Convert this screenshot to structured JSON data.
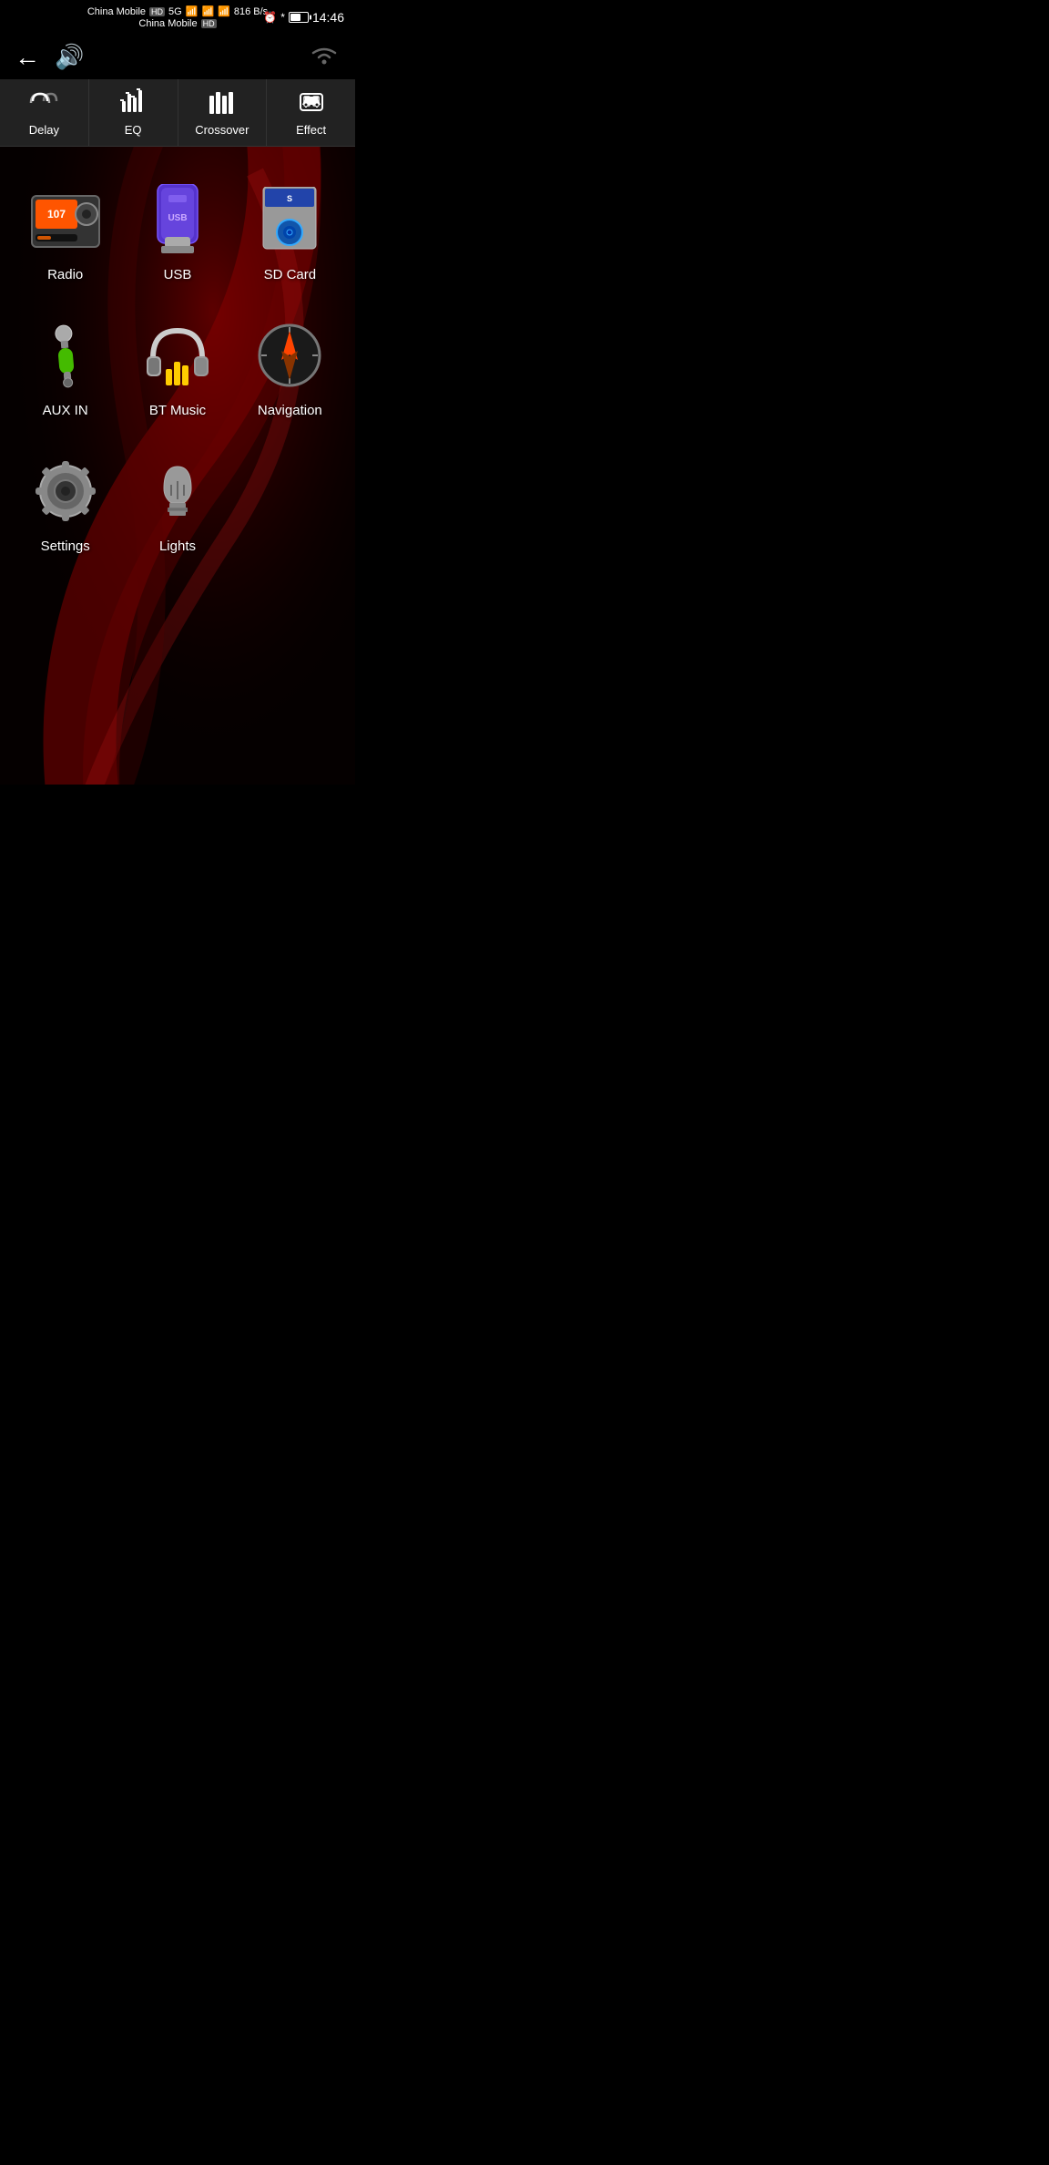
{
  "status_bar": {
    "carrier1": "China Mobile",
    "carrier2": "China Mobile",
    "hd1": "HD",
    "hd2": "HD",
    "network": "5G",
    "speed": "816 B/s",
    "time": "14:46",
    "battery_pct": 61
  },
  "top_bar": {
    "back_label": "←",
    "volume_label": "🔊"
  },
  "tabs": [
    {
      "id": "delay",
      "label": "Delay"
    },
    {
      "id": "eq",
      "label": "EQ"
    },
    {
      "id": "crossover",
      "label": "Crossover"
    },
    {
      "id": "effect",
      "label": "Effect"
    }
  ],
  "apps": [
    {
      "id": "radio",
      "label": "Radio"
    },
    {
      "id": "usb",
      "label": "USB"
    },
    {
      "id": "sdcard",
      "label": "SD Card"
    },
    {
      "id": "auxin",
      "label": "AUX IN"
    },
    {
      "id": "btmusic",
      "label": "BT Music"
    },
    {
      "id": "navigation",
      "label": "Navigation"
    },
    {
      "id": "settings",
      "label": "Settings"
    },
    {
      "id": "lights",
      "label": "Lights"
    }
  ]
}
